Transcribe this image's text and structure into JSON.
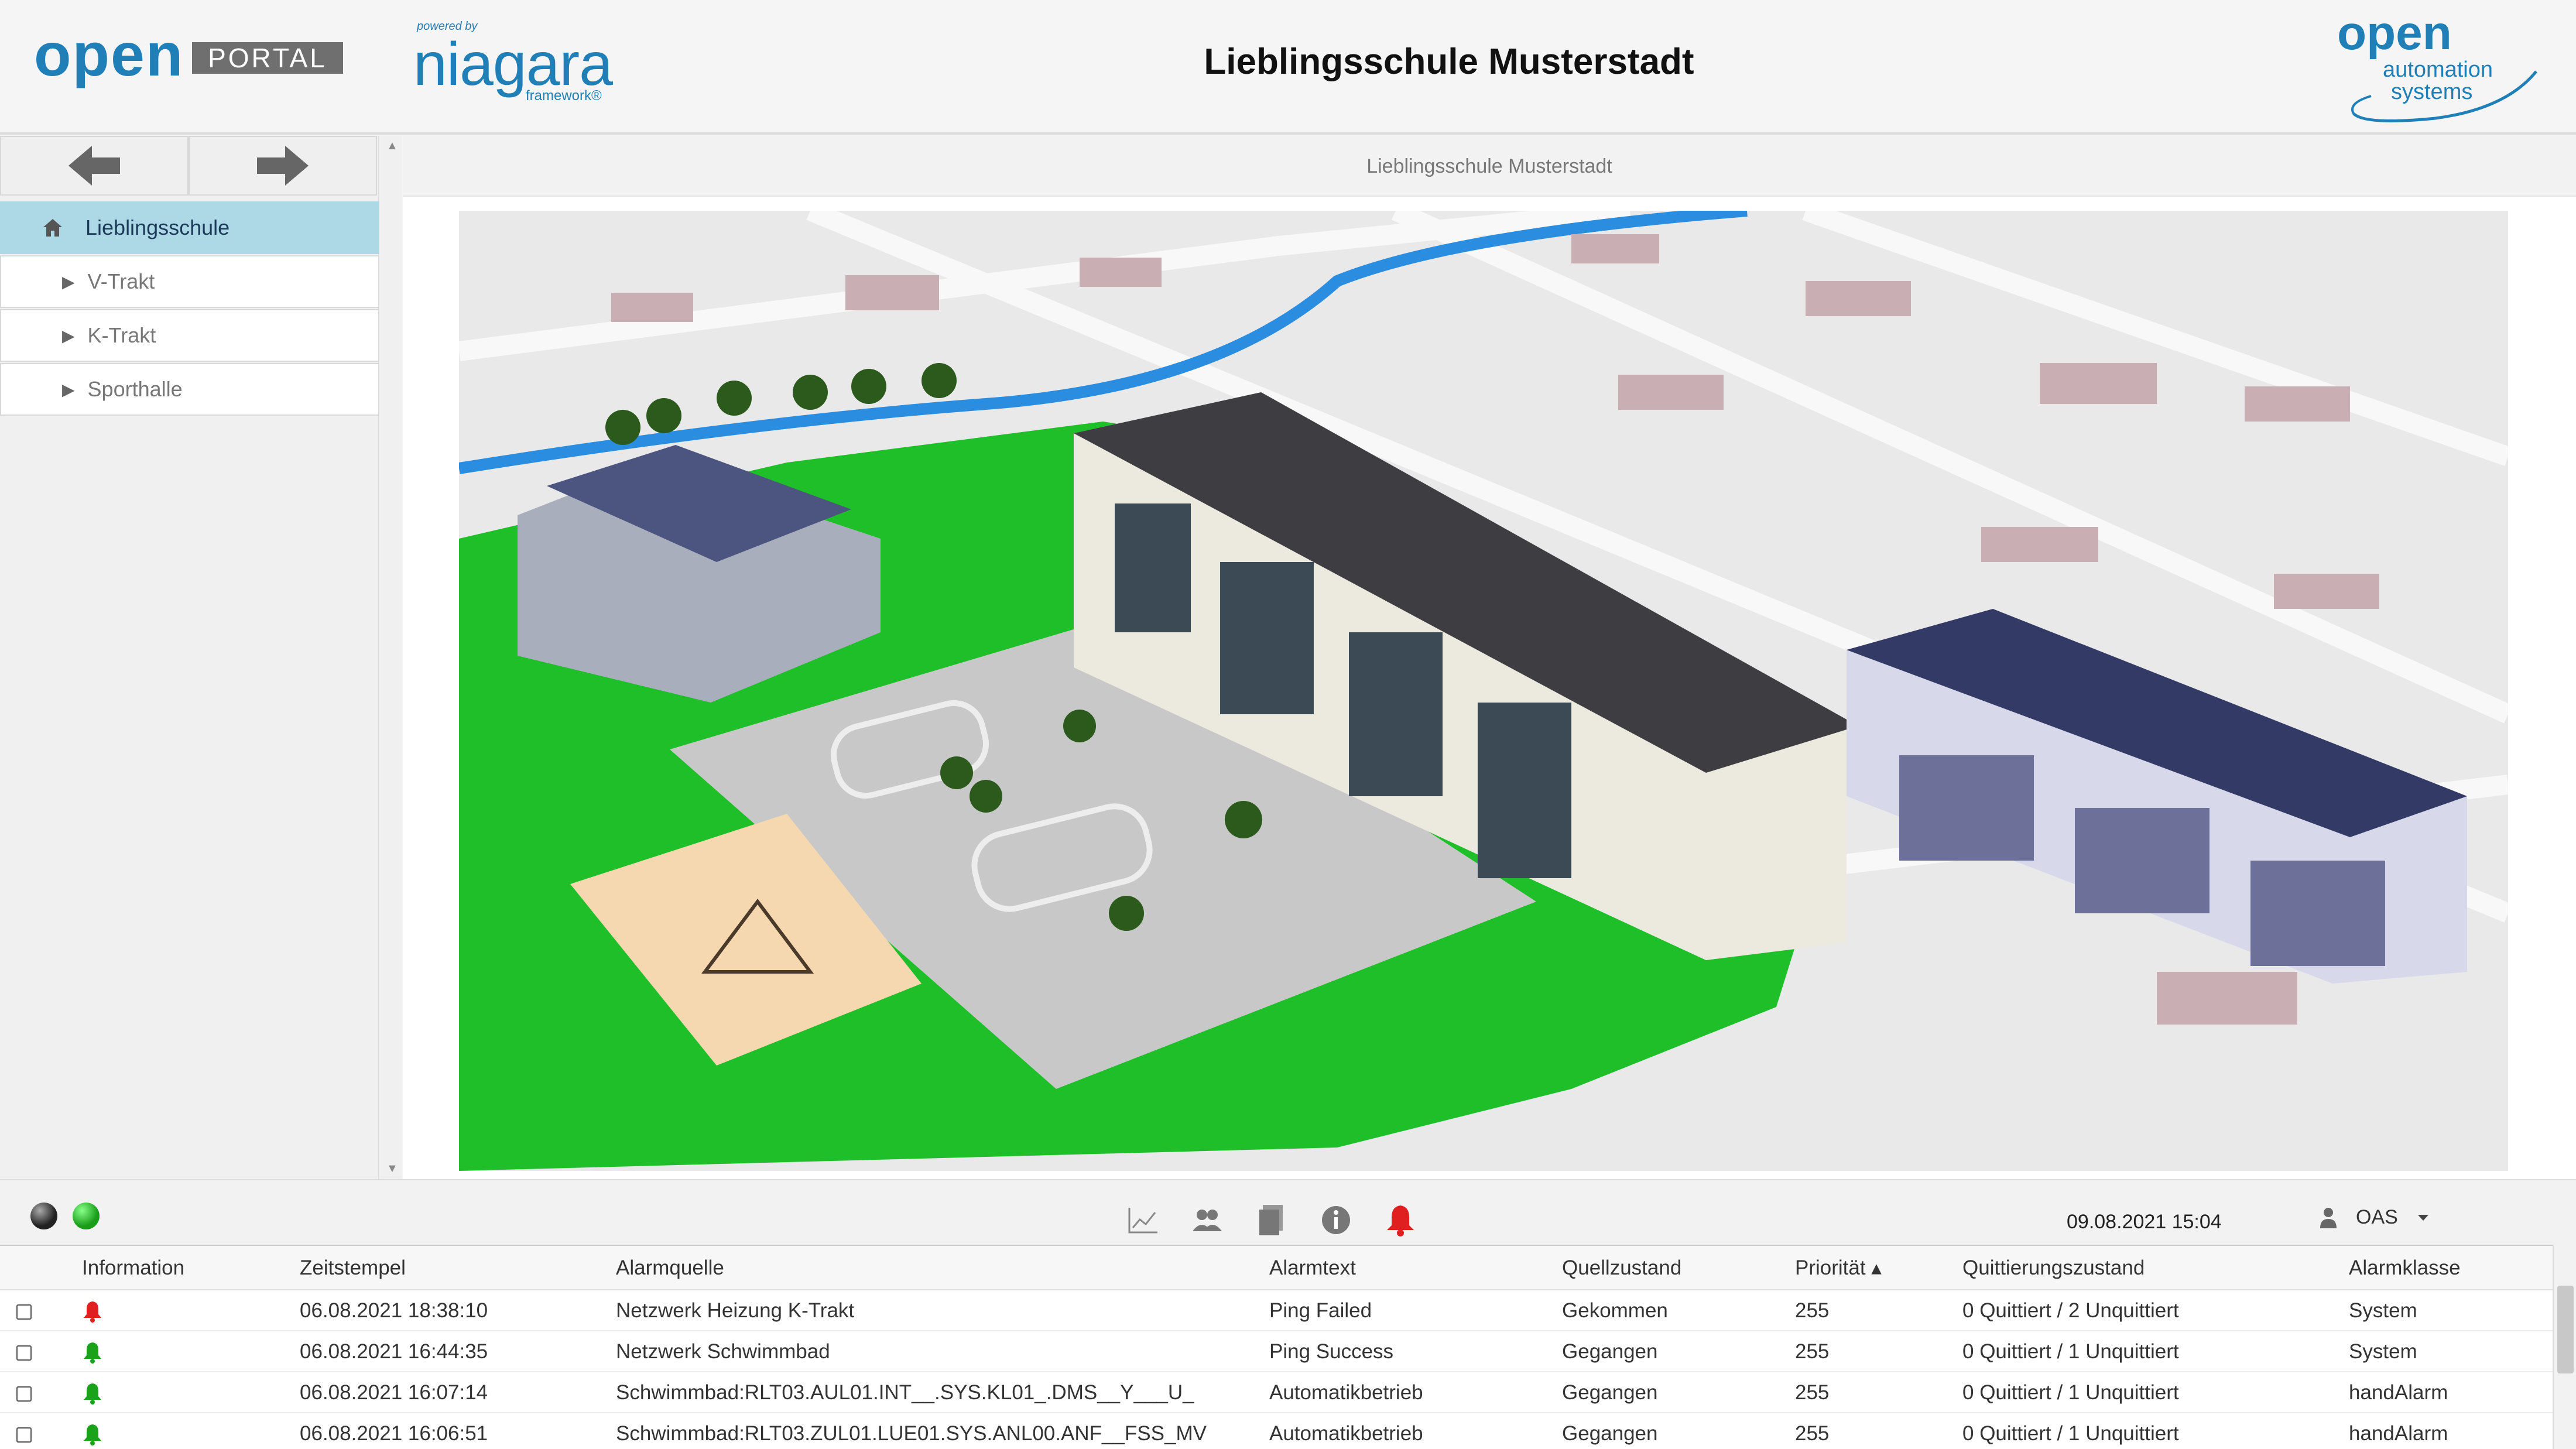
{
  "header": {
    "logo_open": "open",
    "logo_portal": "PORTAL",
    "niagara_powered": "powered by",
    "niagara_name": "niagara",
    "niagara_framework": "framework®",
    "title": "Lieblingsschule Musterstadt",
    "oas_open": "open",
    "oas_line1": "automation",
    "oas_line2": "systems"
  },
  "sidebar": {
    "items": [
      {
        "label": "Lieblingsschule",
        "icon": "home-icon",
        "selected": true
      },
      {
        "label": "V-Trakt",
        "icon": "caret-right-icon"
      },
      {
        "label": "K-Trakt",
        "icon": "caret-right-icon"
      },
      {
        "label": "Sporthalle",
        "icon": "caret-right-icon"
      }
    ]
  },
  "main": {
    "breadcrumb": "Lieblingsschule Musterstadt"
  },
  "statusbar": {
    "datetime": "09.08.2021 15:04",
    "user": "OAS",
    "icons": [
      "chart-icon",
      "users-icon",
      "document-icon",
      "info-icon",
      "alarm-bell-icon"
    ]
  },
  "colors": {
    "brand_blue": "#1f7fb6",
    "selected_bg": "#add8e6",
    "alarm_red": "#e02020",
    "ok_green": "#1aa31a"
  },
  "alarms": {
    "headers": {
      "information": "Information",
      "zeitstempel": "Zeitstempel",
      "alarmquelle": "Alarmquelle",
      "alarmtext": "Alarmtext",
      "quellzustand": "Quellzustand",
      "prioritaet": "Priorität ▴",
      "quittierung": "Quittierungszustand",
      "alarmklasse": "Alarmklasse"
    },
    "rows": [
      {
        "bell": "red",
        "zeit": "06.08.2021 18:38:10",
        "quelle": "Netzwerk Heizung K-Trakt",
        "text": "Ping Failed",
        "zustand": "Gekommen",
        "prio": "255",
        "quitt": "0 Quittiert / 2 Unquittiert",
        "klasse": "System"
      },
      {
        "bell": "green",
        "zeit": "06.08.2021 16:44:35",
        "quelle": "Netzwerk Schwimmbad",
        "text": "Ping Success",
        "zustand": "Gegangen",
        "prio": "255",
        "quitt": "0 Quittiert / 1 Unquittiert",
        "klasse": "System"
      },
      {
        "bell": "green",
        "zeit": "06.08.2021 16:07:14",
        "quelle": "Schwimmbad:RLT03.AUL01.INT__.SYS.KL01_.DMS__Y___U_",
        "text": "Automatikbetrieb",
        "zustand": "Gegangen",
        "prio": "255",
        "quitt": "0 Quittiert / 1 Unquittiert",
        "klasse": "handAlarm"
      },
      {
        "bell": "green",
        "zeit": "06.08.2021 16:06:51",
        "quelle": "Schwimmbad:RLT03.ZUL01.LUE01.SYS.ANL00.ANF__FSS_MV",
        "text": "Automatikbetrieb",
        "zustand": "Gegangen",
        "prio": "255",
        "quitt": "0 Quittiert / 1 Unquittiert",
        "klasse": "handAlarm"
      }
    ]
  }
}
